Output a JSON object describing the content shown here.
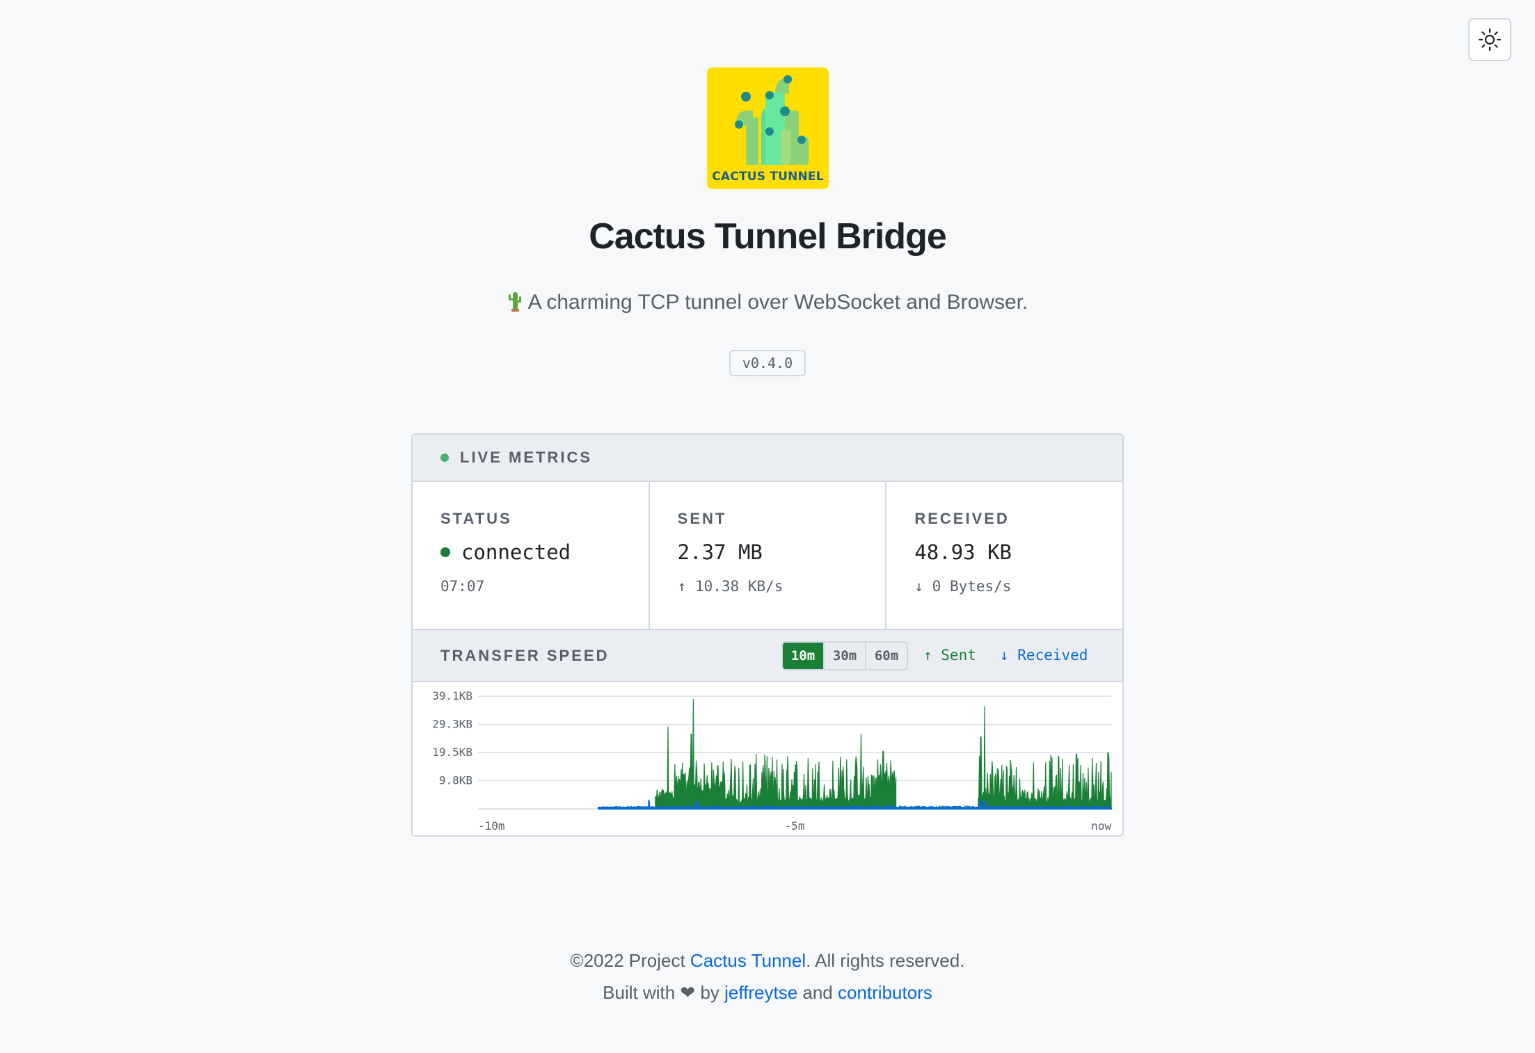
{
  "app": {
    "title": "Cactus Tunnel Bridge",
    "subtitle": "A charming TCP tunnel over WebSocket and Browser.",
    "version": "v0.4.0",
    "logo_text": "CACTUS TUNNEL"
  },
  "theme_toggle": {
    "icon": "sun-icon"
  },
  "live_metrics": {
    "header": "LIVE METRICS",
    "status": {
      "label": "STATUS",
      "value": "connected",
      "sub": "07:07"
    },
    "sent": {
      "label": "SENT",
      "value": "2.37 MB",
      "arrow": "↑",
      "rate": "10.38 KB/s"
    },
    "received": {
      "label": "RECEIVED",
      "value": "48.93 KB",
      "arrow": "↓",
      "rate": "0 Bytes/s"
    }
  },
  "transfer_speed": {
    "header": "TRANSFER SPEED",
    "ranges": [
      "10m",
      "30m",
      "60m"
    ],
    "active_range": "10m",
    "legend_sent": "↑ Sent",
    "legend_received": "↓ Received"
  },
  "colors": {
    "accent_green": "#1a7f37",
    "accent_blue": "#0969da",
    "logo_yellow": "#ffde00"
  },
  "chart_data": {
    "type": "area",
    "y_ticks": [
      "39.1KB",
      "29.3KB",
      "19.5KB",
      "9.8KB"
    ],
    "y_tick_values_kb": [
      39.1,
      29.3,
      19.5,
      9.8
    ],
    "x_ticks": [
      "-10m",
      "-5m",
      "now"
    ],
    "x_tick_minutes": [
      -10,
      -5,
      0
    ],
    "xlim_minutes": [
      -10,
      0
    ],
    "ylim_kb": [
      0,
      39.1
    ],
    "grid": true,
    "series": [
      {
        "name": "Sent",
        "color": "#1a7f37",
        "segments": [
          {
            "start": -8.1,
            "end": -7.2,
            "base": 0.2,
            "noise": 0.3,
            "spikes": []
          },
          {
            "start": -7.2,
            "end": -6.9,
            "base": 3.0,
            "noise": 4.0,
            "spikes": [
              [
                -7.0,
                28.5
              ]
            ]
          },
          {
            "start": -6.9,
            "end": -6.1,
            "base": 5.0,
            "noise": 12.0,
            "spikes": [
              [
                -6.6,
                38.0
              ],
              [
                -6.63,
                26.0
              ]
            ]
          },
          {
            "start": -6.1,
            "end": -3.75,
            "base": 2.0,
            "noise": 17.0,
            "spikes": [
              [
                -3.95,
                26.0
              ]
            ]
          },
          {
            "start": -3.75,
            "end": -3.4,
            "base": 6.0,
            "noise": 14.0,
            "spikes": [
              [
                -3.6,
                20.0
              ]
            ]
          },
          {
            "start": -3.4,
            "end": -2.1,
            "base": 0.3,
            "noise": 0.8,
            "spikes": []
          },
          {
            "start": -2.1,
            "end": -1.7,
            "base": 3.0,
            "noise": 16.0,
            "spikes": [
              [
                -2.0,
                35.5
              ],
              [
                -2.06,
                25.0
              ]
            ]
          },
          {
            "start": -1.7,
            "end": 0.0,
            "base": 2.0,
            "noise": 17.0,
            "spikes": [
              [
                -0.55,
                19.0
              ],
              [
                -0.05,
                19.5
              ]
            ]
          }
        ]
      },
      {
        "name": "Received",
        "color": "#0969da",
        "segments": [
          {
            "start": -8.1,
            "end": 0.0,
            "base": 0.4,
            "noise": 0.2,
            "spikes": [
              [
                -7.3,
                3.0
              ],
              [
                -6.55,
                2.5
              ],
              [
                -3.5,
                1.5
              ],
              [
                -2.05,
                2.5
              ],
              [
                -2.0,
                3.2
              ]
            ]
          }
        ]
      }
    ]
  },
  "footer": {
    "copyright_prefix": "©2022 Project ",
    "project_link": "Cactus Tunnel",
    "copyright_suffix": ". All rights reserved.",
    "built_prefix": "Built with ",
    "heart": "❤",
    "built_by": " by ",
    "author_link": "jeffreytse",
    "and": " and ",
    "contributors_link": "contributors"
  }
}
